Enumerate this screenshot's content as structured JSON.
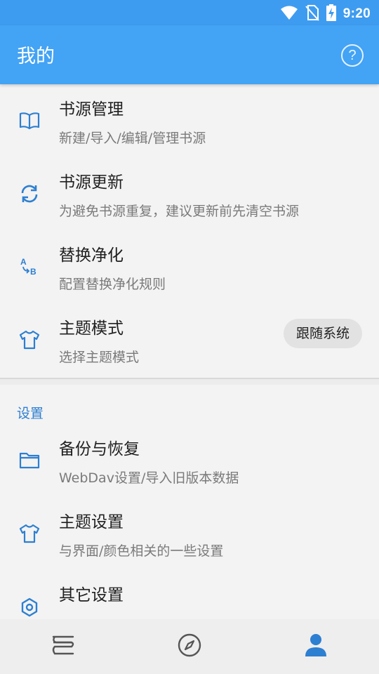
{
  "status_bar": {
    "time": "9:20",
    "icons": [
      "wifi-icon",
      "no-sim-icon",
      "battery-charging-icon"
    ]
  },
  "app_bar": {
    "title": "我的",
    "help_icon": "help-circle-icon",
    "help_glyph": "?"
  },
  "list": [
    {
      "title": "书源管理",
      "subtitle": "新建/导入/编辑/管理书源",
      "icon": "book-open-icon"
    },
    {
      "title": "书源更新",
      "subtitle": "为避免书源重复，建议更新前先清空书源",
      "icon": "sync-icon"
    },
    {
      "title": "替换净化",
      "subtitle": "配置替换净化规则",
      "icon": "replace-ab-icon"
    },
    {
      "title": "主题模式",
      "subtitle": "选择主题模式",
      "icon": "tshirt-icon",
      "value": "跟随系统"
    }
  ],
  "settings_section": {
    "header": "设置",
    "items": [
      {
        "title": "备份与恢复",
        "subtitle": "WebDav设置/导入旧版本数据",
        "icon": "folder-icon"
      },
      {
        "title": "主题设置",
        "subtitle": "与界面/颜色相关的一些设置",
        "icon": "tshirt-icon"
      },
      {
        "title": "其它设置",
        "subtitle": "",
        "icon": "settings-hex-icon"
      }
    ]
  },
  "bottom_nav": {
    "items": [
      {
        "name": "bookshelf",
        "icon": "bookshelf-icon",
        "active": false
      },
      {
        "name": "discover",
        "icon": "compass-icon",
        "active": false
      },
      {
        "name": "mine",
        "icon": "person-icon",
        "active": true
      }
    ]
  },
  "colors": {
    "accent": "#2d7fd1",
    "appbar": "#43a3f5",
    "statusbar": "#3e9cf0",
    "nav_inactive": "#555555"
  }
}
